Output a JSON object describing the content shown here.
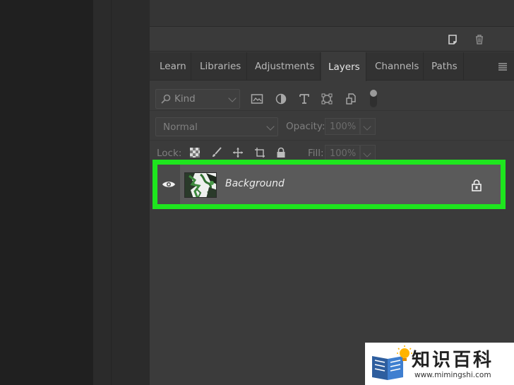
{
  "tabs": [
    {
      "label": "Learn",
      "active": false
    },
    {
      "label": "Libraries",
      "active": false
    },
    {
      "label": "Adjustments",
      "active": false
    },
    {
      "label": "Layers",
      "active": true
    },
    {
      "label": "Channels",
      "active": false
    },
    {
      "label": "Paths",
      "active": false
    }
  ],
  "filter": {
    "kind_label": "Kind"
  },
  "blend": {
    "mode": "Normal",
    "opacity_label": "Opacity:",
    "opacity_value": "100%"
  },
  "lock": {
    "label": "Lock:",
    "fill_label": "Fill:",
    "fill_value": "100%"
  },
  "layer": {
    "name": "Background",
    "visible": true,
    "locked": true
  },
  "highlight_color": "#1ee61e",
  "watermark": {
    "title": "知识百科",
    "url": "www.mimingshi.com"
  }
}
